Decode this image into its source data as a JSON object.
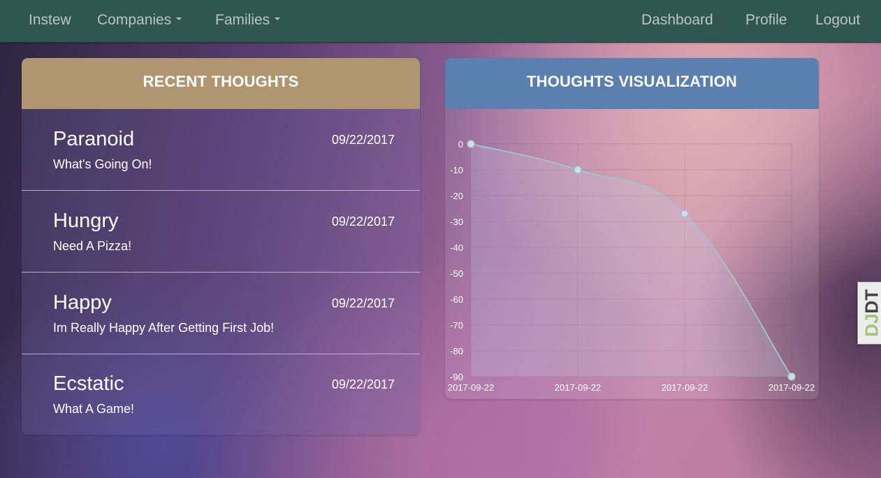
{
  "navbar": {
    "brand": "Instew",
    "companies": "Companies",
    "families": "Families",
    "dashboard": "Dashboard",
    "profile": "Profile",
    "logout": "Logout"
  },
  "recent_thoughts": {
    "title": "RECENT THOUGHTS",
    "items": [
      {
        "mood": "Paranoid",
        "date": "09/22/2017",
        "text": "What's Going On!"
      },
      {
        "mood": "Hungry",
        "date": "09/22/2017",
        "text": "Need A Pizza!"
      },
      {
        "mood": "Happy",
        "date": "09/22/2017",
        "text": "Im Really Happy After Getting First Job!"
      },
      {
        "mood": "Ecstatic",
        "date": "09/22/2017",
        "text": "What A Game!"
      }
    ]
  },
  "visualization": {
    "title": "THOUGHTS VISUALIZATION"
  },
  "chart_data": {
    "type": "line",
    "categories": [
      "2017-09-22",
      "2017-09-22",
      "2017-09-22",
      "2017-09-22"
    ],
    "values": [
      0,
      -10,
      -27,
      -90
    ],
    "ylim": [
      -90,
      0
    ],
    "yticks": [
      0,
      -10,
      -20,
      -30,
      -40,
      -50,
      -60,
      -70,
      -80,
      -90
    ],
    "grid": true,
    "line_color": "#9fc2cd"
  },
  "debug_toolbar": {
    "label_part1": "DJ",
    "label_part2": "DT"
  },
  "colors": {
    "navbar": "#305651",
    "thoughts_header": "#b09570",
    "viz_header": "#5b80af"
  },
  "icons": [
    "caret-down-icon",
    "caret-down-icon"
  ]
}
